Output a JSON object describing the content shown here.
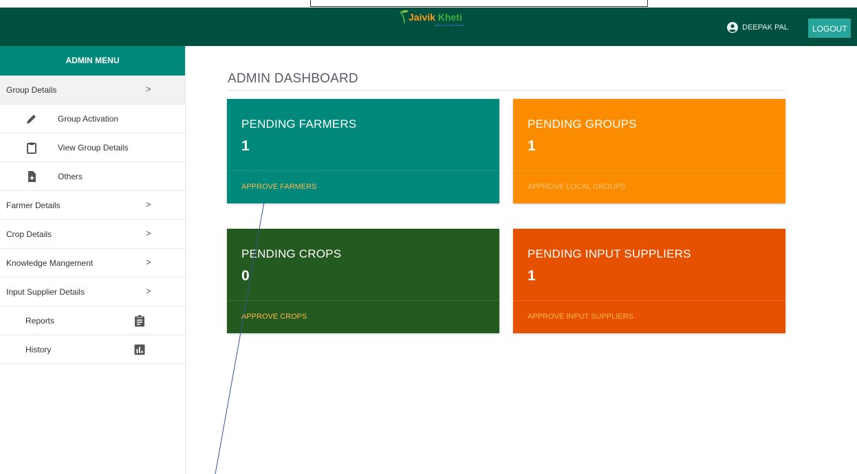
{
  "brand": {
    "logo_main": "Jaivik",
    "logo_accent": "Kheti",
    "logo_tagline": "Sampurna Krishi Bharati",
    "color_nav": "#00503f",
    "color_accent": "#26a69a"
  },
  "header": {
    "user_icon": "account-circle-icon",
    "user_name": "DEEPAK PAL",
    "logout_label": "LOGOUT"
  },
  "sidebar": {
    "title": "ADMIN MENU",
    "group_details": {
      "label": "Group Details",
      "chevron": ">"
    },
    "group_children": [
      {
        "label": "Group Activation",
        "icon": "pencil-icon"
      },
      {
        "label": "View Group Details",
        "icon": "clipboard-icon"
      },
      {
        "label": "Others",
        "icon": "file-plus-icon"
      }
    ],
    "sections": [
      {
        "label": "Farmer Details",
        "chevron": ">"
      },
      {
        "label": "Crop Details",
        "chevron": ">"
      },
      {
        "label": "Knowledge Mangement",
        "chevron": ">"
      },
      {
        "label": "Input Supplier Details",
        "chevron": ">"
      }
    ],
    "extras": [
      {
        "label": "Reports",
        "icon": "assignment-icon"
      },
      {
        "label": "History",
        "icon": "bar-chart-icon"
      }
    ]
  },
  "main": {
    "title": "ADMIN DASHBOARD",
    "cards": [
      {
        "title": "PENDING FARMERS",
        "count": "1",
        "link": "APPROVE FARMERS",
        "color": "#00897b",
        "link_color": "#ffb74d"
      },
      {
        "title": "PENDING GROUPS",
        "count": "1",
        "link": "APPROVE LOCAL GROUPS",
        "color": "#fb8c00",
        "link_color": "#ffc27a"
      },
      {
        "title": "PENDING CROPS",
        "count": "0",
        "link": "APPROVE CROPS",
        "color": "#235a1f",
        "link_color": "#ffb74d"
      },
      {
        "title": "PENDING INPUT SUPPLIERS",
        "count": "1",
        "link": "APPROVE INPUT SUPPLIERS",
        "color": "#e65100",
        "link_color": "#ffb74d"
      }
    ]
  }
}
